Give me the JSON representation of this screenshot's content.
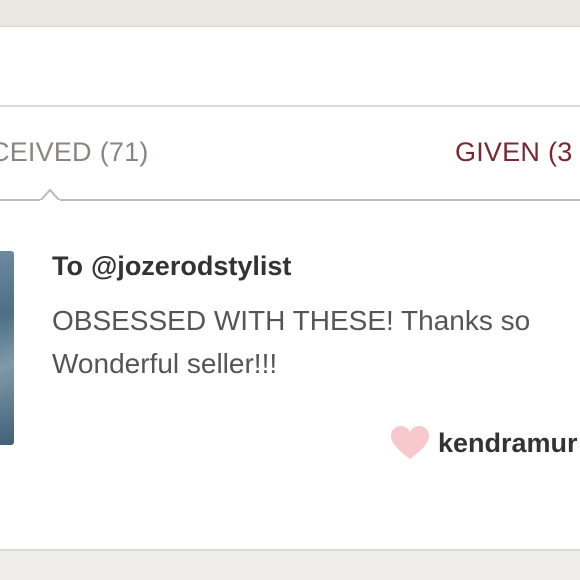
{
  "tabs": {
    "received": {
      "label": "CEIVED",
      "count": "(71)"
    },
    "given": {
      "label": "GIVEN",
      "count": "(3"
    }
  },
  "feedback": {
    "to_prefix": "To",
    "to_handle": "@jozerodstylist",
    "message_lines": [
      "OBSESSED WITH THESE! Thanks so",
      "Wonderful seller!!!"
    ],
    "author": "kendramur",
    "icons": {
      "like": "heart-icon"
    }
  },
  "colors": {
    "given_tab": "#7b2634",
    "received_tab": "#8a8580",
    "heart": "#f7c9cc"
  }
}
